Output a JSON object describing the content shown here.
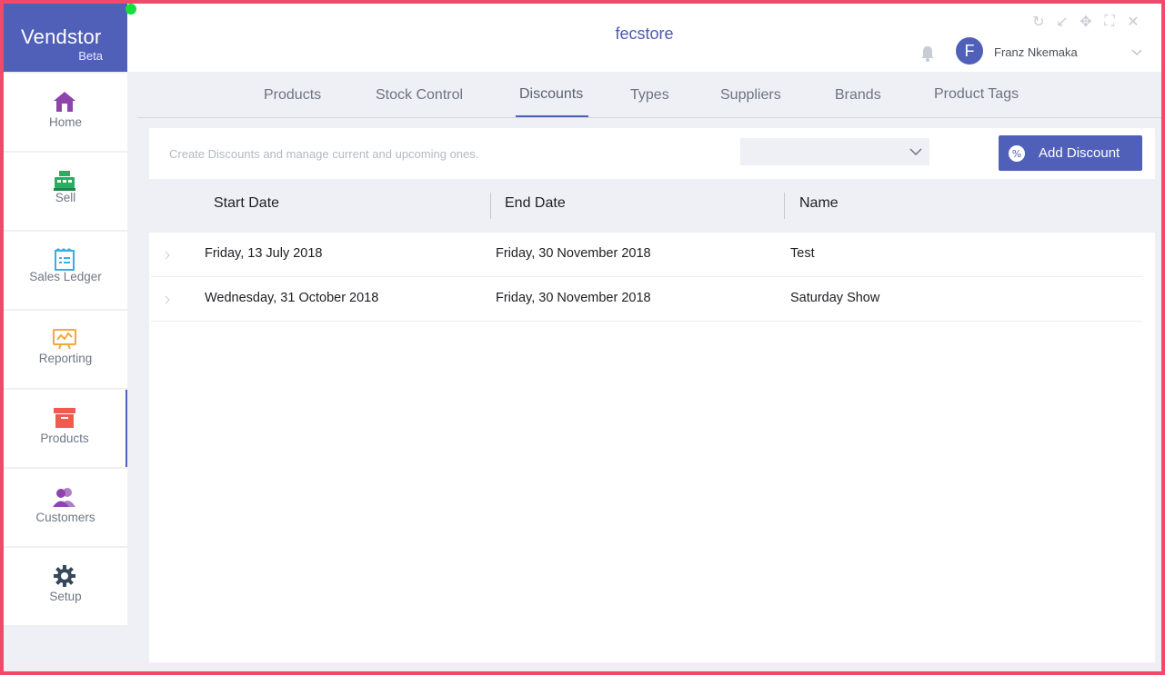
{
  "brand": {
    "name": "Vendstor",
    "sub": "Beta"
  },
  "sidebar": {
    "items": [
      {
        "label": "Home",
        "icon": "home-icon",
        "color": "#8e44ad"
      },
      {
        "label": "Sell",
        "icon": "register-icon",
        "color": "#27ae60"
      },
      {
        "label": "Sales Ledger",
        "icon": "ledger-icon",
        "color": "#3aaee0"
      },
      {
        "label": "Reporting",
        "icon": "chart-board-icon",
        "color": "#f0a93b"
      },
      {
        "label": "Products",
        "icon": "box-icon",
        "color": "#ef5b4f"
      },
      {
        "label": "Customers",
        "icon": "users-icon",
        "color": "#9b59b6"
      },
      {
        "label": "Setup",
        "icon": "gear-icon",
        "color": "#34495e"
      }
    ],
    "active": "Products"
  },
  "header": {
    "store": "fecstore",
    "user_initial": "F",
    "user_name": "Franz Nkemaka"
  },
  "tabs": [
    {
      "label": "Products"
    },
    {
      "label": "Stock Control"
    },
    {
      "label": "Discounts",
      "active": true
    },
    {
      "label": "Types"
    },
    {
      "label": "Suppliers"
    },
    {
      "label": "Brands"
    },
    {
      "label": "Product Tags"
    }
  ],
  "toolbar": {
    "hint": "Create Discounts and manage current and upcoming ones.",
    "filter_value": "",
    "add_label": "Add Discount"
  },
  "table": {
    "headers": [
      "Start Date",
      "End Date",
      "Name"
    ],
    "rows": [
      {
        "start": "Friday, 13 July 2018",
        "end": "Friday, 30 November 2018",
        "name": "Test"
      },
      {
        "start": "Wednesday, 31 October 2018",
        "end": "Friday, 30 November 2018",
        "name": "Saturday Show"
      }
    ]
  },
  "colors": {
    "accent": "#5060b8",
    "frame": "#f2486a",
    "status_dot": "#11e03b"
  }
}
